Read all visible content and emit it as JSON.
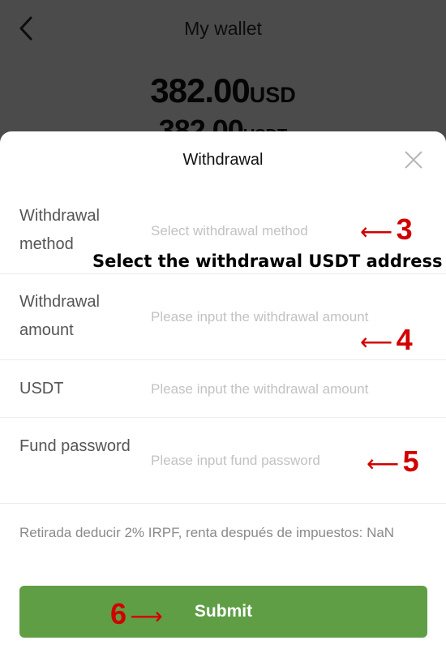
{
  "header": {
    "title": "My wallet",
    "balance_usd_value": "382.00",
    "balance_usd_unit": "USD",
    "balance_usdt_value": "382.00",
    "balance_usdt_unit": "USDT"
  },
  "modal": {
    "title": "Withdrawal",
    "fields": [
      {
        "label": "Withdrawal method",
        "placeholder": "Select withdrawal method",
        "value": ""
      },
      {
        "label": "Withdrawal amount",
        "placeholder": "Please input the withdrawal amount",
        "value": ""
      },
      {
        "label": "USDT",
        "placeholder": "Please input the withdrawal amount",
        "value": ""
      },
      {
        "label": "Fund password",
        "placeholder": "Please input fund password",
        "value": ""
      }
    ],
    "note": "Retirada deducir 2% IRPF, renta después de impuestos: NaN",
    "submit_label": "Submit"
  },
  "annotations": {
    "step3": "3",
    "step4": "4",
    "step5": "5",
    "step6": "6",
    "arrow_left": "⟵",
    "arrow_right": "⟶",
    "caption": "Select the withdrawal USDT address"
  },
  "colors": {
    "accent_green": "#5f9e45",
    "annotation_red": "#d10000",
    "overlay": "#4b4b4b"
  },
  "icons": [
    "back-arrow-icon",
    "close-icon"
  ]
}
